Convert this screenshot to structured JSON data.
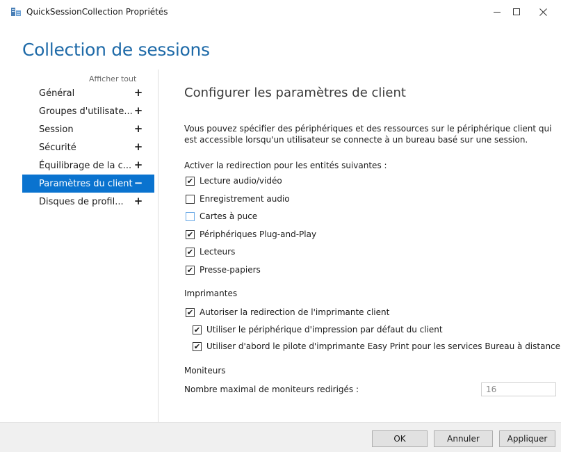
{
  "window": {
    "title": "QuickSessionCollection Propriétés",
    "icon": "server-manager-icon"
  },
  "header": {
    "title": "Collection de sessions"
  },
  "sidebar": {
    "show_all": "Afficher tout",
    "items": [
      {
        "label": "Général",
        "sign": "+",
        "selected": false
      },
      {
        "label": "Groupes d'utilisate...",
        "sign": "+",
        "selected": false
      },
      {
        "label": "Session",
        "sign": "+",
        "selected": false
      },
      {
        "label": "Sécurité",
        "sign": "+",
        "selected": false
      },
      {
        "label": "Équilibrage de la c...",
        "sign": "+",
        "selected": false
      },
      {
        "label": "Paramètres du client",
        "sign": "−",
        "selected": true
      },
      {
        "label": "Disques de profil...",
        "sign": "+",
        "selected": false
      }
    ]
  },
  "main": {
    "title": "Configurer les paramètres de client",
    "description": "Vous pouvez spécifier des périphériques et des ressources sur le périphérique client qui est accessible lorsqu'un utilisateur se connecte à un bureau basé sur une session.",
    "redirection_label": "Activer la redirection pour les entités suivantes :",
    "redirection_options": [
      {
        "label": "Lecture audio/vidéo",
        "checked": true
      },
      {
        "label": "Enregistrement audio",
        "checked": false
      },
      {
        "label": "Cartes à puce",
        "checked": false
      },
      {
        "label": "Périphériques Plug-and-Play",
        "checked": true
      },
      {
        "label": "Lecteurs",
        "checked": true
      },
      {
        "label": "Presse-papiers",
        "checked": true
      }
    ],
    "printers_label": "Imprimantes",
    "printer_options": [
      {
        "label": "Autoriser la redirection de l'imprimante client",
        "checked": true
      },
      {
        "label": "Utiliser le périphérique d'impression par défaut du client",
        "checked": true
      },
      {
        "label": "Utiliser d'abord le pilote d'imprimante Easy Print pour les services Bureau à distance",
        "checked": true
      }
    ],
    "monitors_label": "Moniteurs",
    "max_monitors_label": "Nombre maximal de moniteurs redirigés :",
    "max_monitors_value": "16"
  },
  "footer": {
    "ok": "OK",
    "cancel": "Annuler",
    "apply": "Appliquer"
  },
  "colors": {
    "accent": "#0a73cf",
    "header_title": "#1e6aa8"
  }
}
